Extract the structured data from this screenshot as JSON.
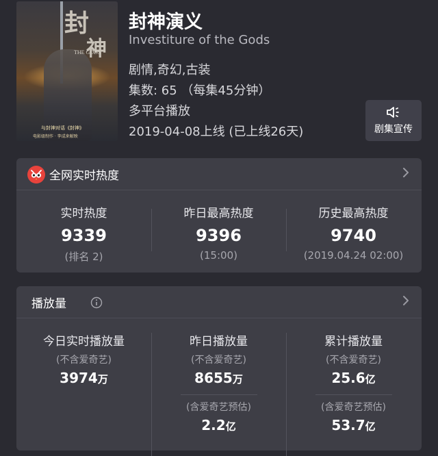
{
  "show": {
    "title": "封神演义",
    "english_title": "Investiture of the Gods",
    "genres": "剧情,奇幻,古装",
    "episodes": "集数: 65 （每集45分钟）",
    "platform": "多平台播放",
    "release": "2019-04-08上线 (已上线26天)",
    "poster": {
      "calligraphy_1": "封",
      "calligraphy_2": "神",
      "subtitle": "THE GODS",
      "caption_1": "与封神对话《封神》",
      "caption_2": "电影级制作 · 李成来献映"
    }
  },
  "promo_button": {
    "label": "剧集宣传",
    "icon": "speaker-icon"
  },
  "heat_card": {
    "title": "全网实时热度",
    "icon": "owl-logo-icon",
    "columns": [
      {
        "label": "实时热度",
        "value": "9339",
        "sub": "(排名 2)"
      },
      {
        "label": "昨日最高热度",
        "value": "9396",
        "sub": "(15:00)"
      },
      {
        "label": "历史最高热度",
        "value": "9740",
        "sub": "(2019.04.24 02:00)"
      }
    ]
  },
  "play_card": {
    "title": "播放量",
    "info_icon": "info-icon",
    "columns": [
      {
        "label": "今日实时播放量",
        "note": "(不含爱奇艺)",
        "value": "3974",
        "unit": "万"
      },
      {
        "label": "昨日播放量",
        "note": "(不含爱奇艺)",
        "value": "8655",
        "unit": "万",
        "note2": "(含爱奇艺预估)",
        "value2": "2.2",
        "unit2": "亿"
      },
      {
        "label": "累计播放量",
        "note": "(不含爱奇艺)",
        "value": "25.6",
        "unit": "亿",
        "note2": "(含爱奇艺预估)",
        "value2": "53.7",
        "unit2": "亿"
      }
    ]
  },
  "colors": {
    "background": "#2a2a31",
    "card": "#3e3e46",
    "accent_red": "#e8433c"
  }
}
